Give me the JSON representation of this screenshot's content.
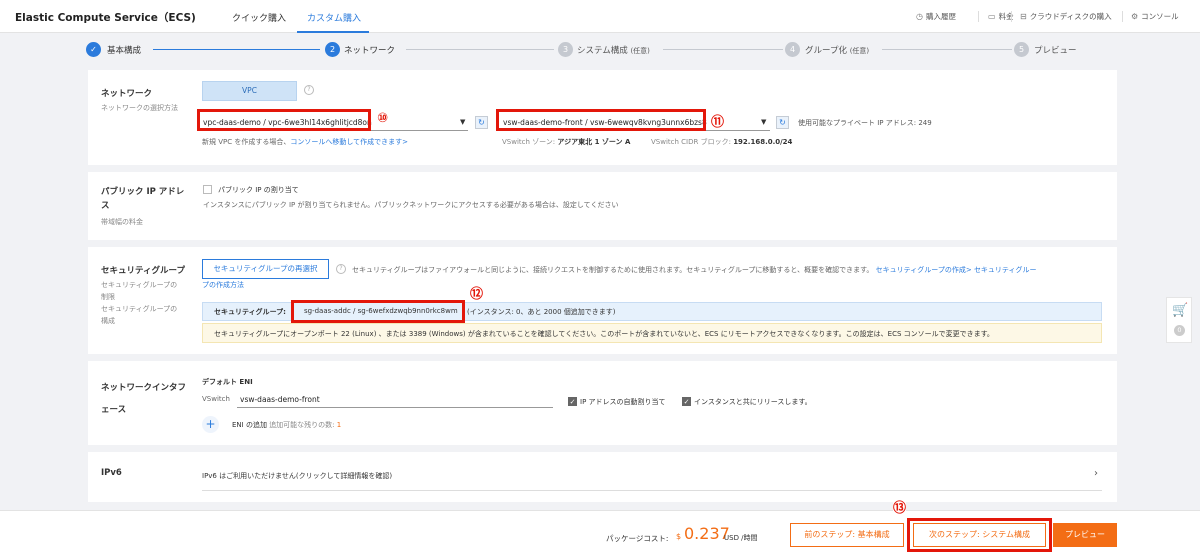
{
  "header": {
    "app_title": "Elastic Compute Service（ECS)",
    "tabs": [
      "クイック購入",
      "カスタム購入"
    ],
    "links": {
      "history": "購入履歴",
      "price": "料金",
      "cloud_disk": "クラウドディスクの購入",
      "console": "コンソール"
    }
  },
  "steps": [
    {
      "num": "✓",
      "label": "基本構成",
      "state": "done"
    },
    {
      "num": "2",
      "label": "ネットワーク",
      "state": "active"
    },
    {
      "num": "3",
      "label": "システム構成",
      "opt": "(任意)",
      "state": "todo"
    },
    {
      "num": "4",
      "label": "グループ化",
      "opt": "(任意)",
      "state": "todo"
    },
    {
      "num": "5",
      "label": "プレビュー",
      "state": "todo"
    }
  ],
  "network": {
    "title": "ネットワーク",
    "subtitle": "ネットワークの選択方法",
    "vpc_button": "VPC",
    "vpc_value": "vpc-daas-demo / vpc-6we3hl14x6ghlitjcd8on",
    "new_vpc_note": "新規 VPC を作成する場合、",
    "new_vpc_link": "コンソールへ移動して作成できます>",
    "vswitch_value": "vsw-daas-demo-front / vsw-6wewqv8kvng3unnx6bzs8",
    "available_ip": "使用可能なプライベート IP アドレス:  249",
    "zone_label": "VSwitch ゾーン:",
    "zone_value": "アジア東北 1 ゾーン A",
    "cidr_label": "VSwitch CIDR ブロック:",
    "cidr_value": "192.168.0.0/24",
    "marker_10": "⑩",
    "marker_11": "⑪"
  },
  "public_ip": {
    "title_line1": "パブリック IP アドレ",
    "title_line2": "ス",
    "subtitle": "帯域幅の料金",
    "checkbox_label": "パブリック IP の割り当て",
    "note": "インスタンスにパブリック IP が割り当てられません。パブリックネットワークにアクセスする必要がある場合は、設定してください"
  },
  "security_group": {
    "title": "セキュリティグループ",
    "subtitle": [
      "セキュリティグループの",
      "制限",
      "セキュリティグループの",
      "構成"
    ],
    "reselect_button": "セキュリティグループの再選択",
    "desc": "セキュリティグループはファイアウォールと同じように、接続リクエストを制御するために使用されます。セキュリティグループに移動すると、概要を確認できます。",
    "link1": "セキュリティグループの作成>",
    "link2a": "セキュリティグルー",
    "link2b": "プの作成方法",
    "selected_label": "セキュリティグループ:",
    "selected_value": "sg-daas-addc / sg-6wefxdzwqb9nn0rkc8wm",
    "instances_note": "(インスタンス:  0、あと 2000 個追加できます)",
    "warning": "セキュリティグループにオープンポート 22 (Linux) 、または 3389 (Windows) が含まれていることを確認してください。このポートが含まれていないと、ECS にリモートアクセスできなくなります。この設定は、ECS コンソールで変更できます。",
    "marker_12": "⑫"
  },
  "eni": {
    "title_line1": "ネットワークインタフ",
    "title_line2": "ェース",
    "default_label": "デフォルト ENI",
    "vswitch_label": "VSwitch",
    "vswitch_value": "vsw-daas-demo-front",
    "auto_ip": "IP アドレスの自動割り当て",
    "release_with_instance": "インスタンスと共にリリースします。",
    "add_label": "ENI の追加",
    "remaining": "追加可能な残りの数: ",
    "remaining_count": "1"
  },
  "ipv6": {
    "title": "IPv6",
    "note": "IPv6 はご利用いただけません(クリックして詳細情報を確認)"
  },
  "footer": {
    "package_cost_label": "パッケージコスト:",
    "currency": "$",
    "amount": "0.237",
    "unit": "USD /時間",
    "prev_button": "前のステップ:  基本構成",
    "next_button": "次のステップ:  システム構成",
    "preview_button": "プレビュー",
    "marker_13": "⑬"
  },
  "cart": {
    "count": "0"
  },
  "colors": {
    "accent_blue": "#2b7bdc",
    "accent_orange": "#f36d15",
    "annotation_red": "#e3170a"
  }
}
